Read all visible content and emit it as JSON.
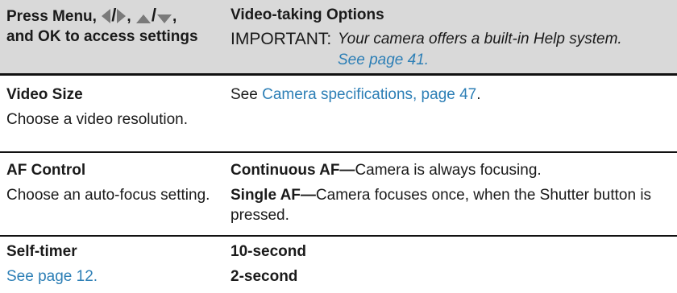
{
  "header": {
    "col1_line1_prefix": "Press Menu,",
    "col1_sep1": "/",
    "col1_after_lr": ",",
    "col1_sep2": "/",
    "col1_after_ud": ",",
    "col1_line2": "and OK to access settings",
    "col2_title": "Video-taking Options",
    "important_label": "IMPORTANT:",
    "important_text": "Your camera offers a built-in Help system.",
    "important_link": "See page 41."
  },
  "rows": [
    {
      "setting": "Video Size",
      "description": "Choose a video resolution.",
      "option_prefix": "See",
      "option_link": "Camera specifications, page 47",
      "option_suffix": "."
    },
    {
      "setting": "AF Control",
      "description": "Choose an auto-focus setting.",
      "options": [
        {
          "bold": "Continuous AF—",
          "text": "Camera is always focusing."
        },
        {
          "bold": "Single AF—",
          "text": "Camera focuses once, when the Shutter button is",
          "text2": "pressed."
        }
      ]
    },
    {
      "setting": "Self-timer",
      "description_link": "See page 12.",
      "options": [
        "10-second",
        "2-second"
      ]
    }
  ],
  "colors": {
    "header_bg": "#d9d9d9",
    "link": "#2d7fb6",
    "rule": "#111111"
  },
  "icons": [
    "left-arrow-icon",
    "right-arrow-icon",
    "up-arrow-icon",
    "down-arrow-icon"
  ]
}
